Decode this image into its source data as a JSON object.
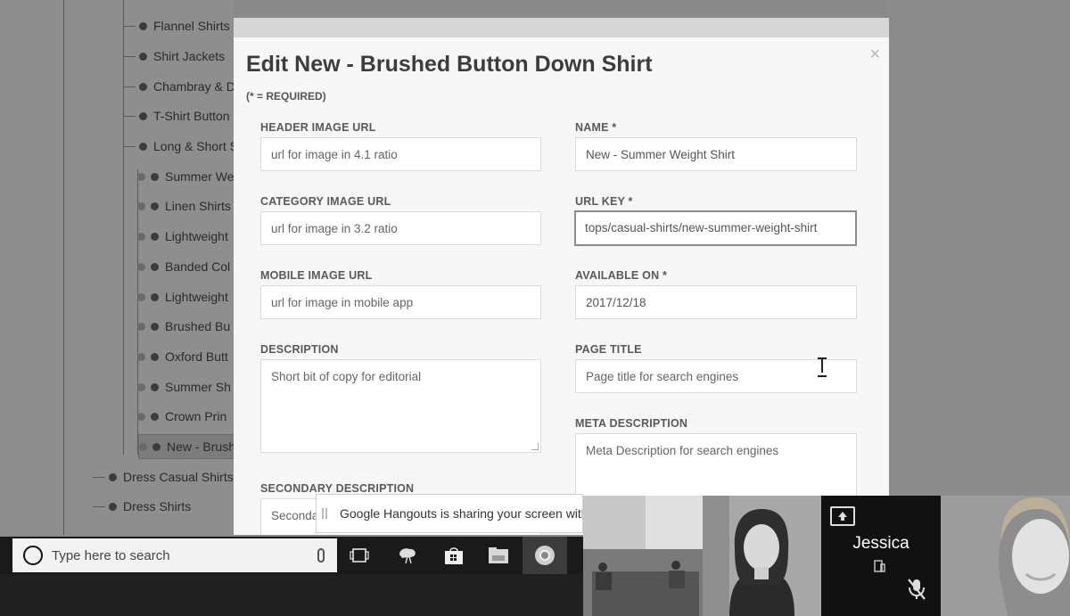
{
  "tree": {
    "items": [
      {
        "label": "Flannel Shirts"
      },
      {
        "label": "Shirt Jackets"
      },
      {
        "label": "Chambray & D"
      },
      {
        "label": "T-Shirt Button"
      },
      {
        "label": "Long & Short S"
      },
      {
        "label": "Summer We"
      },
      {
        "label": "Linen Shirts"
      },
      {
        "label": "Lightweight"
      },
      {
        "label": "Banded Col"
      },
      {
        "label": "Lightweight"
      },
      {
        "label": "Brushed Bu"
      },
      {
        "label": "Oxford Butt"
      },
      {
        "label": "Summer Sh"
      },
      {
        "label": "Crown Prin"
      },
      {
        "label": "New - Brush"
      },
      {
        "label": "Dress Casual Shirts"
      },
      {
        "label": "Dress Shirts"
      }
    ]
  },
  "modal": {
    "title": "Edit New - Brushed Button Down Shirt",
    "close": "×",
    "required_note": "(* = REQUIRED)",
    "fields": {
      "header_image": {
        "label": "HEADER IMAGE URL",
        "placeholder": "url for image in 4.1 ratio"
      },
      "category_image": {
        "label": "CATEGORY IMAGE URL",
        "placeholder": "url for image in 3.2 ratio"
      },
      "mobile_image": {
        "label": "MOBILE IMAGE URL",
        "placeholder": "url for image in mobile app"
      },
      "description": {
        "label": "DESCRIPTION",
        "placeholder": "Short bit of copy for editorial"
      },
      "secondary_description": {
        "label": "SECONDARY  DESCRIPTION",
        "placeholder": "Seconda"
      },
      "name": {
        "label": "NAME *",
        "value": "New - Summer Weight Shirt"
      },
      "url_key": {
        "label": "URL KEY *",
        "value": "tops/casual-shirts/new-summer-weight-shirt"
      },
      "available_on": {
        "label": "AVAILABLE ON *",
        "value": "2017/12/18"
      },
      "page_title": {
        "label": "PAGE TITLE",
        "placeholder": "Page title for search engines"
      },
      "meta_description": {
        "label": "META DESCRIPTION",
        "placeholder": "Meta Description for search engines"
      }
    }
  },
  "share_banner": {
    "text": "Google Hangouts is sharing your screen with han"
  },
  "taskbar": {
    "search_placeholder": "Type here to search"
  },
  "video": {
    "presenter_name": "Jessica"
  }
}
